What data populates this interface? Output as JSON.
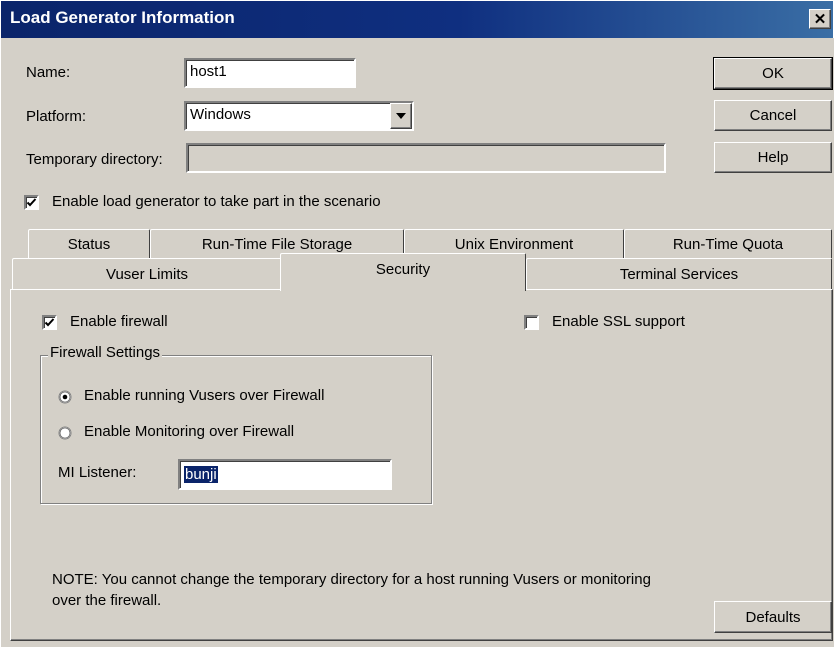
{
  "window": {
    "title": "Load Generator Information"
  },
  "form": {
    "name_label": "Name:",
    "name_value": "host1",
    "platform_label": "Platform:",
    "platform_value": "Windows",
    "tempdir_label": "Temporary directory:",
    "tempdir_value": "",
    "enable_label": "Enable load generator to take part in the scenario",
    "enable_checked": true
  },
  "buttons": {
    "ok": "OK",
    "cancel": "Cancel",
    "help": "Help",
    "defaults": "Defaults"
  },
  "tabs": {
    "row1": [
      "Status",
      "Run-Time File Storage",
      "Unix Environment",
      "Run-Time Quota"
    ],
    "row2": [
      "Vuser Limits",
      "Security",
      "Terminal Services"
    ],
    "active": "Security"
  },
  "security": {
    "firewall_label": "Enable firewall",
    "firewall_checked": true,
    "ssl_label": "Enable SSL support",
    "ssl_checked": false,
    "group_title": "Firewall Settings",
    "radio_vusers": "Enable running Vusers over Firewall",
    "radio_monitoring": "Enable Monitoring over Firewall",
    "radio_selected": "vusers",
    "ml_label": "MI Listener:",
    "ml_value": "bunji",
    "note": "NOTE: You cannot change the temporary directory for a host running Vusers or monitoring over the firewall."
  }
}
